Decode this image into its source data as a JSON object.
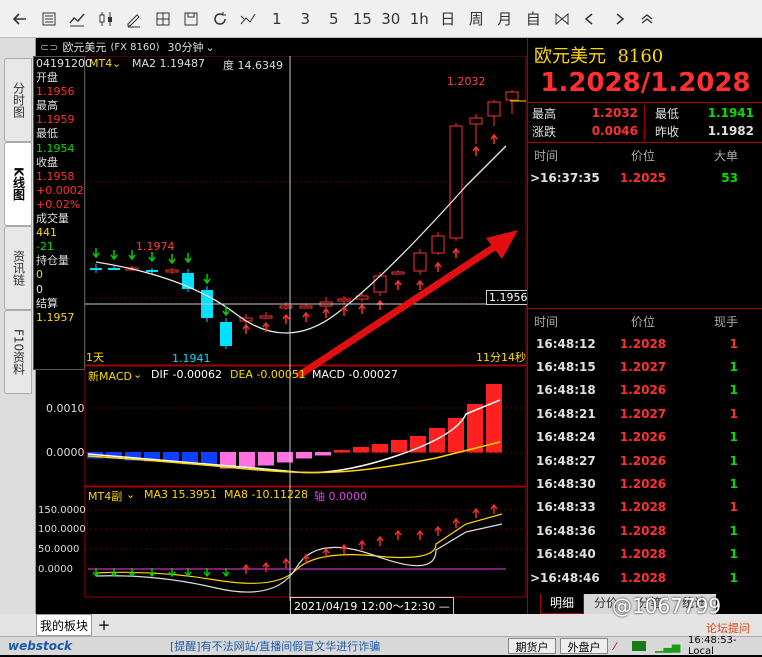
{
  "toolbar": {
    "icons": [
      "back-icon",
      "list-icon",
      "line-chart-icon",
      "candle-icon",
      "edit-chart-icon",
      "grid-chart-icon",
      "save-icon",
      "refresh-icon",
      "draw-icon"
    ],
    "periods": [
      "1",
      "3",
      "5",
      "15",
      "30",
      "1h",
      "日",
      "周",
      "月",
      "自"
    ],
    "tail_icons": [
      "bowtie-icon",
      "left-arrow-icon",
      "right-arrow-icon",
      "double-up-icon"
    ]
  },
  "left_tabs": [
    {
      "label": "分时图"
    },
    {
      "label": "K线图"
    },
    {
      "label": "资讯链"
    },
    {
      "label": "F10资料"
    }
  ],
  "chart_header": {
    "symbol": "欧元美元",
    "code": "(FX 8160)",
    "period": "30分钟"
  },
  "info": {
    "date": "04191200",
    "open_label": "开盘",
    "open": "1.1956",
    "high_label": "最高",
    "high": "1.1959",
    "low_label": "最低",
    "low": "1.1954",
    "close_label": "收盘",
    "close": "1.1958",
    "chg": "+0.0002",
    "chg_pct": "+0.02%",
    "vol_label": "成交量",
    "vol": "441",
    "vol2": "-21",
    "oi_label": "持仓量",
    "oi": "0",
    "oi2": "0",
    "settle_label": "结算",
    "settle": "1.1957"
  },
  "main_panel": {
    "indicator": "MT4",
    "ma_text": "MA2 1.19487",
    "du_text": "度 14.6349",
    "high_mark": "1.2032",
    "left_mark": "1.1974",
    "low_mark": "1.1941",
    "cursor_price": "1.1956",
    "period_left": "1天",
    "countdown": "11分14秒"
  },
  "macd_panel": {
    "name": "新MACD",
    "dif": "DIF -0.00062",
    "dea": "DEA -0.00051",
    "macd": "MACD -0.00027",
    "y1": "0.0010",
    "y0": "0.0000"
  },
  "mt4_panel": {
    "name": "MT4副",
    "ma3": "MA3 15.3951",
    "ma8": "MA8 -10.11228",
    "axis": "轴 0.0000",
    "y": [
      "150.0000",
      "100.0000",
      "50.0000",
      "0.0000"
    ]
  },
  "time_label": "2021/04/19 12:00～12:30 —",
  "quote": {
    "name": "欧元美元",
    "code": "8160",
    "bid": "1.2028",
    "ask": "1.2028",
    "high_label": "最高",
    "high": "1.2032",
    "low_label": "最低",
    "low": "1.1941",
    "chg_label": "涨跌",
    "chg": "0.0046",
    "prev_label": "昨收",
    "prev": "1.1982"
  },
  "big_orders": {
    "headers": [
      "时间",
      "价位",
      "大单"
    ],
    "rows": [
      {
        "time": ">16:37:35",
        "price": "1.2025",
        "vol": "53"
      }
    ]
  },
  "ticks": {
    "headers": [
      "时间",
      "价位",
      "现手"
    ],
    "rows": [
      {
        "time": "16:48:12",
        "price": "1.2028",
        "vol": "1",
        "pc": "r",
        "vc": "r"
      },
      {
        "time": "16:48:15",
        "price": "1.2027",
        "vol": "1",
        "pc": "r",
        "vc": "g"
      },
      {
        "time": "16:48:18",
        "price": "1.2026",
        "vol": "1",
        "pc": "r",
        "vc": "g"
      },
      {
        "time": "16:48:21",
        "price": "1.2027",
        "vol": "1",
        "pc": "r",
        "vc": "r"
      },
      {
        "time": "16:48:24",
        "price": "1.2026",
        "vol": "1",
        "pc": "r",
        "vc": "g"
      },
      {
        "time": "16:48:27",
        "price": "1.2026",
        "vol": "1",
        "pc": "r",
        "vc": "g"
      },
      {
        "time": "16:48:30",
        "price": "1.2026",
        "vol": "1",
        "pc": "r",
        "vc": "g"
      },
      {
        "time": "16:48:33",
        "price": "1.2028",
        "vol": "1",
        "pc": "r",
        "vc": "r"
      },
      {
        "time": "16:48:36",
        "price": "1.2028",
        "vol": "1",
        "pc": "r",
        "vc": "g"
      },
      {
        "time": "16:48:40",
        "price": "1.2028",
        "vol": "1",
        "pc": "r",
        "vc": "g"
      },
      {
        "time": ">16:48:46",
        "price": "1.2028",
        "vol": "1",
        "pc": "r",
        "vc": "g"
      }
    ]
  },
  "right_tabs": [
    "明细",
    "分价",
    "分笔",
    "统计"
  ],
  "bottom": {
    "board": "我的板块",
    "add": "+",
    "brand": "webstock",
    "notice": "[提醒]有不法网站/直播间假冒文华进行诈骗",
    "btn1": "期货户",
    "btn2": "外盘户",
    "time": "16:48:53-Local",
    "watermark": "@1067799",
    "forum": "论坛提问"
  },
  "colors": {
    "up": "#ff2020",
    "down": "#00e0ff",
    "dif": "#ffffff",
    "dea": "#ffd800",
    "arrow": "#e01010"
  }
}
